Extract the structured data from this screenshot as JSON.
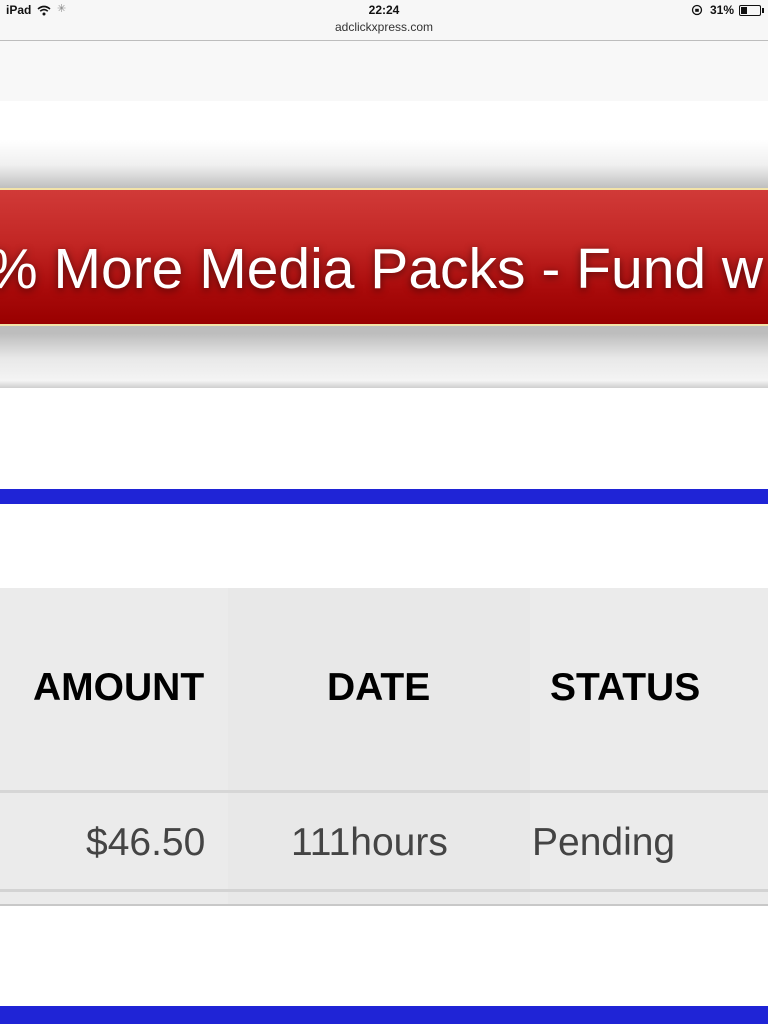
{
  "status_bar": {
    "device": "iPad",
    "time": "22:24",
    "url": "adclickxpress.com",
    "battery": "31%",
    "battery_level": 0.31
  },
  "banner": {
    "text": "% More Media Packs - Fund w"
  },
  "table": {
    "columns": [
      "AMOUNT",
      "DATE",
      "STATUS"
    ],
    "rows": [
      [
        "$46.50",
        "111hours",
        "Pending"
      ]
    ]
  }
}
